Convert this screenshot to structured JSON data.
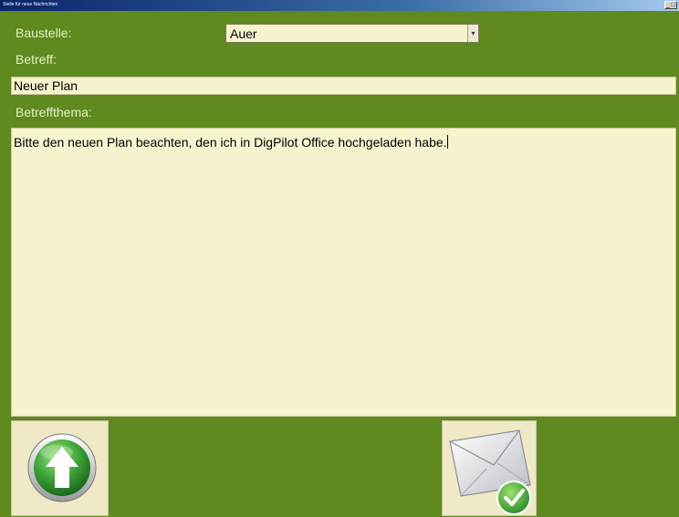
{
  "window": {
    "title": "Stelle für neue Nachrichten",
    "close_glyph": "_ □"
  },
  "form": {
    "baustelle_label": "Baustelle:",
    "baustelle_value": "Auer",
    "combo_arrow": "▾",
    "betreff_label": "Betreff:",
    "betreff_value": "Neuer Plan",
    "thema_label": "Betreffthema:",
    "thema_value": "Bitte den neuen Plan beachten, den ich in DigPilot Office hochgeladen habe."
  },
  "buttons": {
    "up_icon": "arrow-up-icon",
    "send_icon": "mail-check-icon"
  },
  "colors": {
    "background": "#5e8a1f",
    "field": "#f7f3cf",
    "label": "#e8efc4",
    "button_face": "#efe9c8"
  }
}
